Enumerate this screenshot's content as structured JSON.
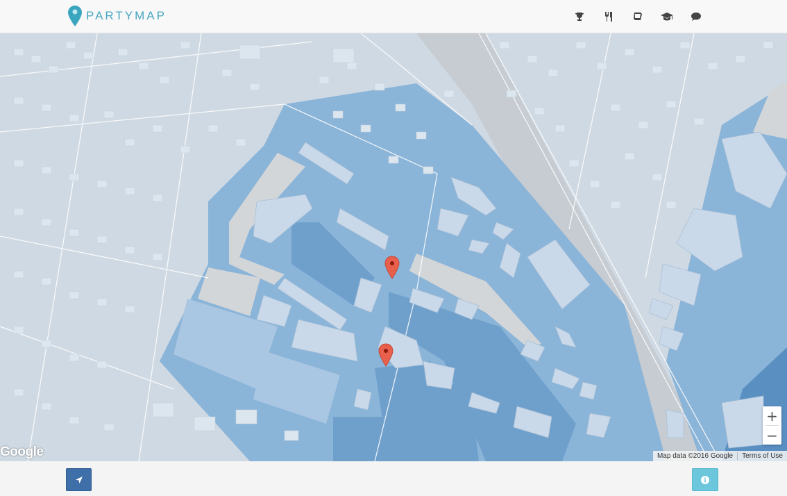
{
  "header": {
    "logo_text": "PARTYMAP",
    "nav": [
      {
        "icon": "trophy-icon"
      },
      {
        "icon": "cutlery-icon"
      },
      {
        "icon": "book-icon"
      },
      {
        "icon": "graduation-cap-icon"
      },
      {
        "icon": "comments-icon"
      }
    ]
  },
  "map": {
    "google_logo": "Google",
    "attribution": "Map data ©2016 Google",
    "terms": "Terms of Use",
    "zoom_in": "+",
    "zoom_out": "−",
    "markers": [
      {
        "name": "marker-1",
        "color": "#e8604c"
      },
      {
        "name": "marker-2",
        "color": "#e8604c"
      }
    ],
    "colors": {
      "land": "#cfd9e3",
      "campus": "#8ab4d8",
      "campus_dark": "#6fa0cc",
      "building": "#dce6ef",
      "path": "#d3d6d8"
    }
  },
  "footer": {
    "locate_icon": "location-arrow-icon",
    "info_icon": "info-icon"
  }
}
